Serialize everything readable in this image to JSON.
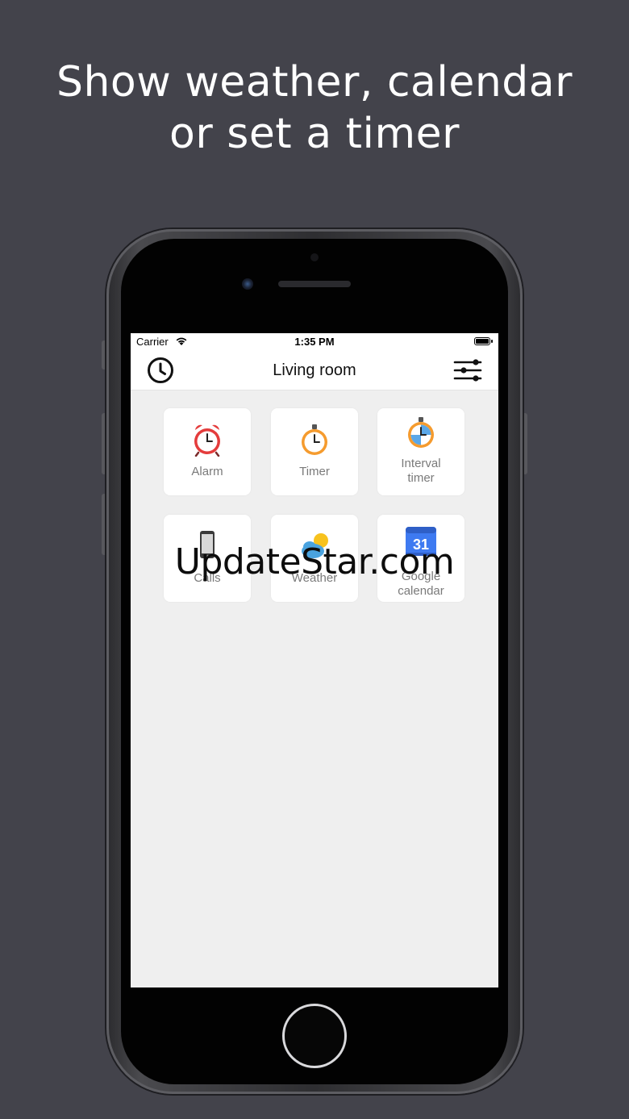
{
  "headline": {
    "line1": "Show weather, calendar",
    "line2": "or set a timer"
  },
  "status_bar": {
    "carrier": "Carrier",
    "time": "1:35 PM"
  },
  "nav": {
    "title": "Living room",
    "left_icon": "clock-icon",
    "right_icon": "sliders-icon"
  },
  "tiles": [
    {
      "label": "Alarm",
      "icon": "alarm-clock-icon"
    },
    {
      "label": "Timer",
      "icon": "timer-icon"
    },
    {
      "label_line1": "Interval",
      "label_line2": "timer",
      "icon": "stopwatch-icon"
    },
    {
      "label": "Calls",
      "icon": "phone-icon"
    },
    {
      "label": "Weather",
      "icon": "weather-icon"
    },
    {
      "label_line1": "Google",
      "label_line2": "calendar",
      "icon": "calendar-icon",
      "icon_text": "31"
    }
  ],
  "watermark": "UpdateStar.com",
  "colors": {
    "background": "#43434b",
    "screen": "#efefef",
    "calendar_blue": "#3e7af1"
  }
}
